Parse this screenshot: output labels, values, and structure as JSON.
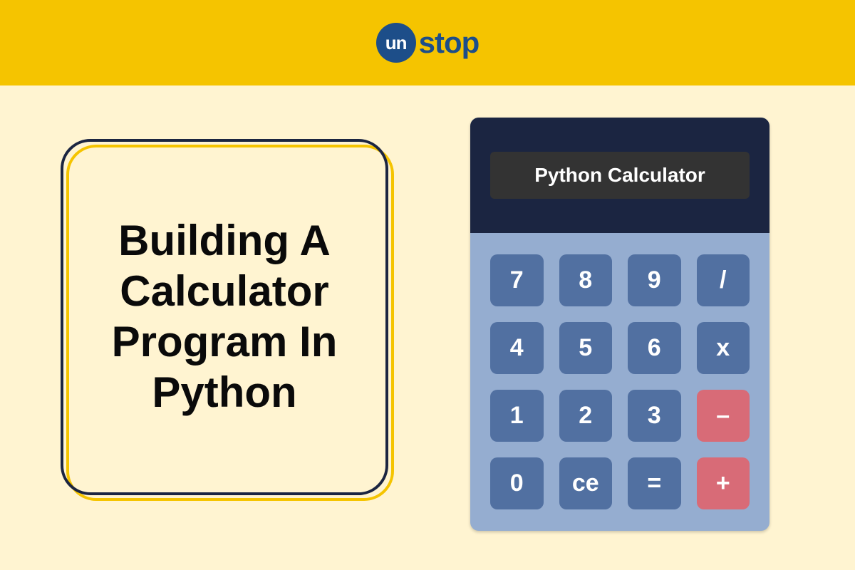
{
  "logo": {
    "circle_text": "un",
    "rest_text": "stop"
  },
  "title": "Building A Calculator Program In Python",
  "calculator": {
    "display": "Python Calculator",
    "keys": [
      {
        "label": "7",
        "name": "key-7",
        "accent": false
      },
      {
        "label": "8",
        "name": "key-8",
        "accent": false
      },
      {
        "label": "9",
        "name": "key-9",
        "accent": false
      },
      {
        "label": "/",
        "name": "key-divide",
        "accent": false
      },
      {
        "label": "4",
        "name": "key-4",
        "accent": false
      },
      {
        "label": "5",
        "name": "key-5",
        "accent": false
      },
      {
        "label": "6",
        "name": "key-6",
        "accent": false
      },
      {
        "label": "x",
        "name": "key-multiply",
        "accent": false
      },
      {
        "label": "1",
        "name": "key-1",
        "accent": false
      },
      {
        "label": "2",
        "name": "key-2",
        "accent": false
      },
      {
        "label": "3",
        "name": "key-3",
        "accent": false
      },
      {
        "label": "–",
        "name": "key-minus",
        "accent": true
      },
      {
        "label": "0",
        "name": "key-0",
        "accent": false
      },
      {
        "label": "ce",
        "name": "key-clear",
        "accent": false
      },
      {
        "label": "=",
        "name": "key-equals",
        "accent": false
      },
      {
        "label": "+",
        "name": "key-plus",
        "accent": true
      }
    ]
  }
}
